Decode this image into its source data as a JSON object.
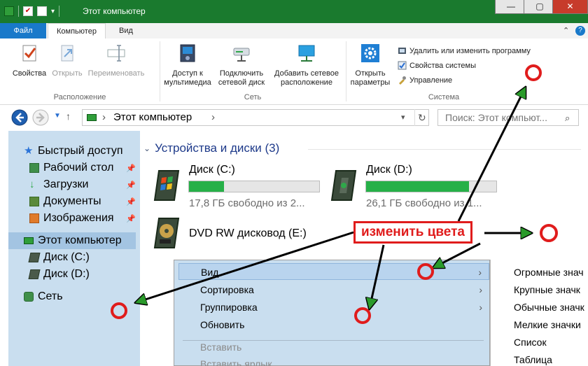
{
  "window": {
    "title": "Этот компьютер"
  },
  "tabs": {
    "file": "Файл",
    "computer": "Компьютер",
    "view": "Вид"
  },
  "ribbon": {
    "groups": {
      "location": "Расположение",
      "network": "Сеть",
      "system": "Система"
    },
    "buttons": {
      "properties": "Свойства",
      "open": "Открыть",
      "rename": "Переименовать",
      "media_1": "Доступ к",
      "media_2": "мультимедиа",
      "netdrive_1": "Подключить",
      "netdrive_2": "сетевой диск",
      "netloc_1": "Добавить сетевое",
      "netloc_2": "расположение",
      "params_1": "Открыть",
      "params_2": "параметры"
    },
    "system_links": {
      "uninstall": "Удалить или изменить программу",
      "sysprops": "Свойства системы",
      "manage": "Управление"
    }
  },
  "address": {
    "path": "Этот компьютер",
    "search_placeholder": "Поиск: Этот компьют..."
  },
  "sidebar": {
    "quick_access": "Быстрый доступ",
    "desktop": "Рабочий стол",
    "downloads": "Загрузки",
    "documents": "Документы",
    "pictures": "Изображения",
    "this_pc": "Этот компьютер",
    "disk_c": "Диск (C:)",
    "disk_d": "Диск (D:)",
    "network": "Сеть"
  },
  "content": {
    "section_title": "Устройства и диски (3)",
    "drives": [
      {
        "name": "Диск (C:)",
        "free": "17,8 ГБ свободно из 2...",
        "used_fraction": 0.27
      },
      {
        "name": "Диск (D:)",
        "free": "26,1 ГБ свободно из 1...",
        "used_fraction": 0.79
      }
    ],
    "dvd": "DVD RW дисковод (E:)"
  },
  "context_menu": {
    "view": "Вид",
    "sort": "Сортировка",
    "group": "Группировка",
    "refresh": "Обновить",
    "paste": "Вставить",
    "paste_shortcut": "Вставить ярлык"
  },
  "submenu": {
    "huge": "Огромные знач",
    "large": "Крупные значк",
    "regular": "Обычные значк",
    "small": "Мелкие значки",
    "list": "Список",
    "table": "Таблица"
  },
  "annotation": {
    "label": "изменить цвета"
  },
  "colors": {
    "title_bar": "#1a7a2e",
    "sidebar_bg": "#c9deef",
    "menu_bg": "#c9deef",
    "annotation_red": "#e01c1c",
    "drive_fill": "#26b048"
  }
}
